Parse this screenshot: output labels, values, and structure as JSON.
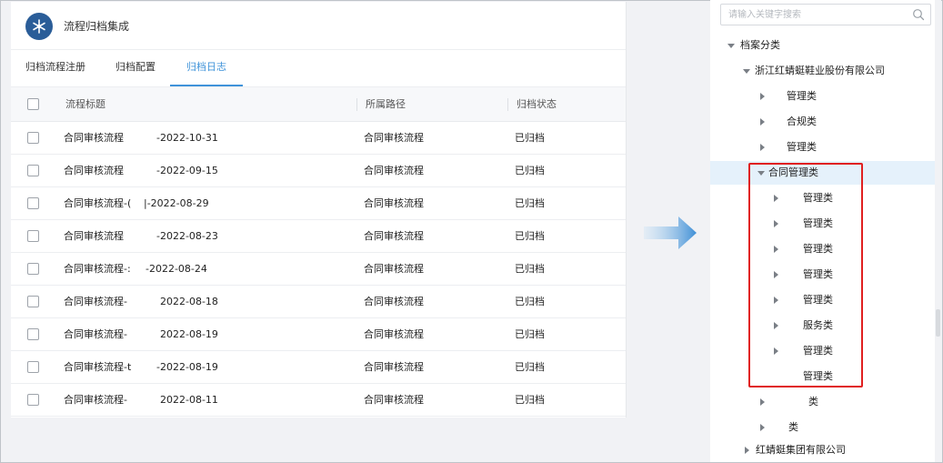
{
  "app": {
    "title": "流程归档集成",
    "logo_icon": "snowflake-icon",
    "brand_color": "#2a5d98"
  },
  "tabs": [
    {
      "label": "归档流程注册",
      "active": false
    },
    {
      "label": "归档配置",
      "active": false
    },
    {
      "label": "归档日志",
      "active": true
    }
  ],
  "table": {
    "columns": [
      "流程标题",
      "所属路径",
      "归档状态"
    ],
    "rows": [
      {
        "title": "合同审核流程",
        "date": "-2022-10-31",
        "path": "合同审核流程",
        "status": "已归档"
      },
      {
        "title": "合同审核流程",
        "date": "-2022-09-15",
        "path": "合同审核流程",
        "status": "已归档"
      },
      {
        "title": "合同审核流程-(",
        "date": "|-2022-08-29",
        "path": "合同审核流程",
        "status": "已归档"
      },
      {
        "title": "合同审核流程",
        "date": "-2022-08-23",
        "path": "合同审核流程",
        "status": "已归档"
      },
      {
        "title": "合同审核流程-:",
        "date": "-2022-08-24",
        "path": "合同审核流程",
        "status": "已归档"
      },
      {
        "title": "合同审核流程-",
        "date": "2022-08-18",
        "path": "合同审核流程",
        "status": "已归档"
      },
      {
        "title": "合同审核流程-",
        "date": "2022-08-19",
        "path": "合同审核流程",
        "status": "已归档"
      },
      {
        "title": "合同审核流程-t",
        "date": "-2022-08-19",
        "path": "合同审核流程",
        "status": "已归档"
      },
      {
        "title": "合同审核流程-",
        "date": "2022-08-11",
        "path": "合同审核流程",
        "status": "已归档"
      }
    ]
  },
  "tree": {
    "search_placeholder": "请输入关键字搜索",
    "nodes": [
      {
        "label": "档案分类",
        "caret": "down"
      },
      {
        "label": "浙江红蜻蜓鞋业股份有限公司",
        "caret": "down"
      },
      {
        "label": "管理类",
        "caret": "right"
      },
      {
        "label": "合规类",
        "caret": "right"
      },
      {
        "label": "管理类",
        "caret": "right"
      },
      {
        "label": "合同管理类",
        "caret": "down",
        "selected": true
      },
      {
        "label": "管理类",
        "caret": "right"
      },
      {
        "label": "管理类",
        "caret": "right"
      },
      {
        "label": "管理类",
        "caret": "right"
      },
      {
        "label": "管理类",
        "caret": "right"
      },
      {
        "label": "管理类",
        "caret": "right"
      },
      {
        "label": "服务类",
        "caret": "right"
      },
      {
        "label": "管理类",
        "caret": "right"
      },
      {
        "label": "管理类",
        "caret": "none"
      },
      {
        "label": "类",
        "caret": "right"
      },
      {
        "label": "类",
        "caret": "right"
      },
      {
        "label": "红蜻蜓集团有限公司",
        "caret": "right"
      }
    ]
  },
  "colors": {
    "accent": "#3f93d9",
    "highlight": "#e02020",
    "selected_bg": "#e5f1fb"
  }
}
